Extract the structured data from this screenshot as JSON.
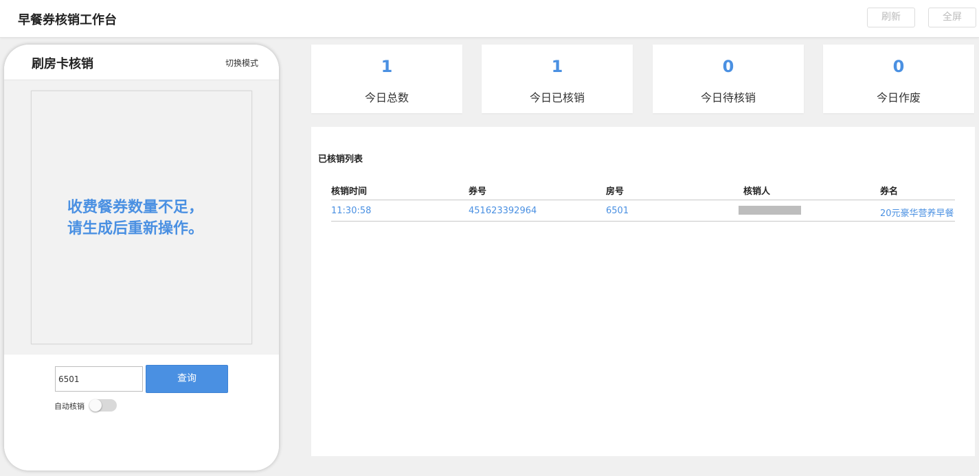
{
  "header": {
    "title": "早餐券核销工作台",
    "refresh_label": "刷新",
    "fullscreen_label": "全屏"
  },
  "phone": {
    "title": "刷房卡核销",
    "switch_mode_label": "切换模式",
    "scan_message_line1": "收费餐券数量不足，",
    "scan_message_line2": "请生成后重新操作。",
    "room_input_value": "6501",
    "query_label": "查询",
    "auto_verify_label": "自动核销",
    "auto_verify_on": false
  },
  "stats": [
    {
      "value": "1",
      "label": "今日总数"
    },
    {
      "value": "1",
      "label": "今日已核销"
    },
    {
      "value": "0",
      "label": "今日待核销"
    },
    {
      "value": "0",
      "label": "今日作废"
    }
  ],
  "list": {
    "title": "已核销列表",
    "columns": [
      "核销时间",
      "券号",
      "房号",
      "核销人",
      "券名"
    ],
    "rows": [
      {
        "time": "11:30:58",
        "coupon_no": "451623392964",
        "room": "6501",
        "operator": "",
        "coupon_name": "20元豪华营养早餐"
      }
    ]
  },
  "colors": {
    "accent": "#4a90e2",
    "background": "#f0f0f0"
  }
}
